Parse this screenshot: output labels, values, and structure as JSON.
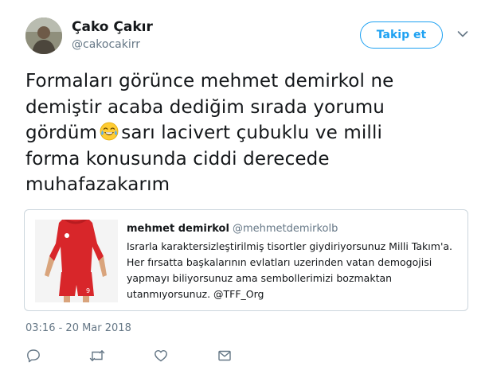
{
  "user": {
    "name": "Çako Çakır",
    "handle": "@cakocakirr"
  },
  "follow_label": "Takip et",
  "tweet": {
    "line1": "Formaları görünce mehmet demirkol ne",
    "line2": "demiştir acaba dediğim sırada yorumu",
    "line3_before": "gördüm",
    "line3_after": "sarı lacivert çubuklu ve milli",
    "line4": "forma konusunda ciddi derecede",
    "line5": "muhafazakarım",
    "emoji": "face-with-tears-of-joy"
  },
  "quoted": {
    "name": "mehmet demirkol",
    "handle": "@mehmetdemirkolb",
    "lines": [
      "Israrla karaktersizleştirilmiş tisortler giydiriyorsunuz Milli Takım'a.",
      "Her fırsatta başkalarının evlatları uzerinden vatan demogojisi",
      "yapmayı biliyorsunuz ama sembollerimizi bozmaktan",
      "utanmıyorsunuz. @TFF_Org"
    ]
  },
  "timestamp": "03:16 - 20 Mar 2018",
  "colors": {
    "accent": "#1da1f2",
    "secondary_text": "#657786",
    "border": "#ccd6dd"
  },
  "icons": [
    "reply-icon",
    "retweet-icon",
    "like-icon",
    "message-icon",
    "chevron-down-icon"
  ]
}
